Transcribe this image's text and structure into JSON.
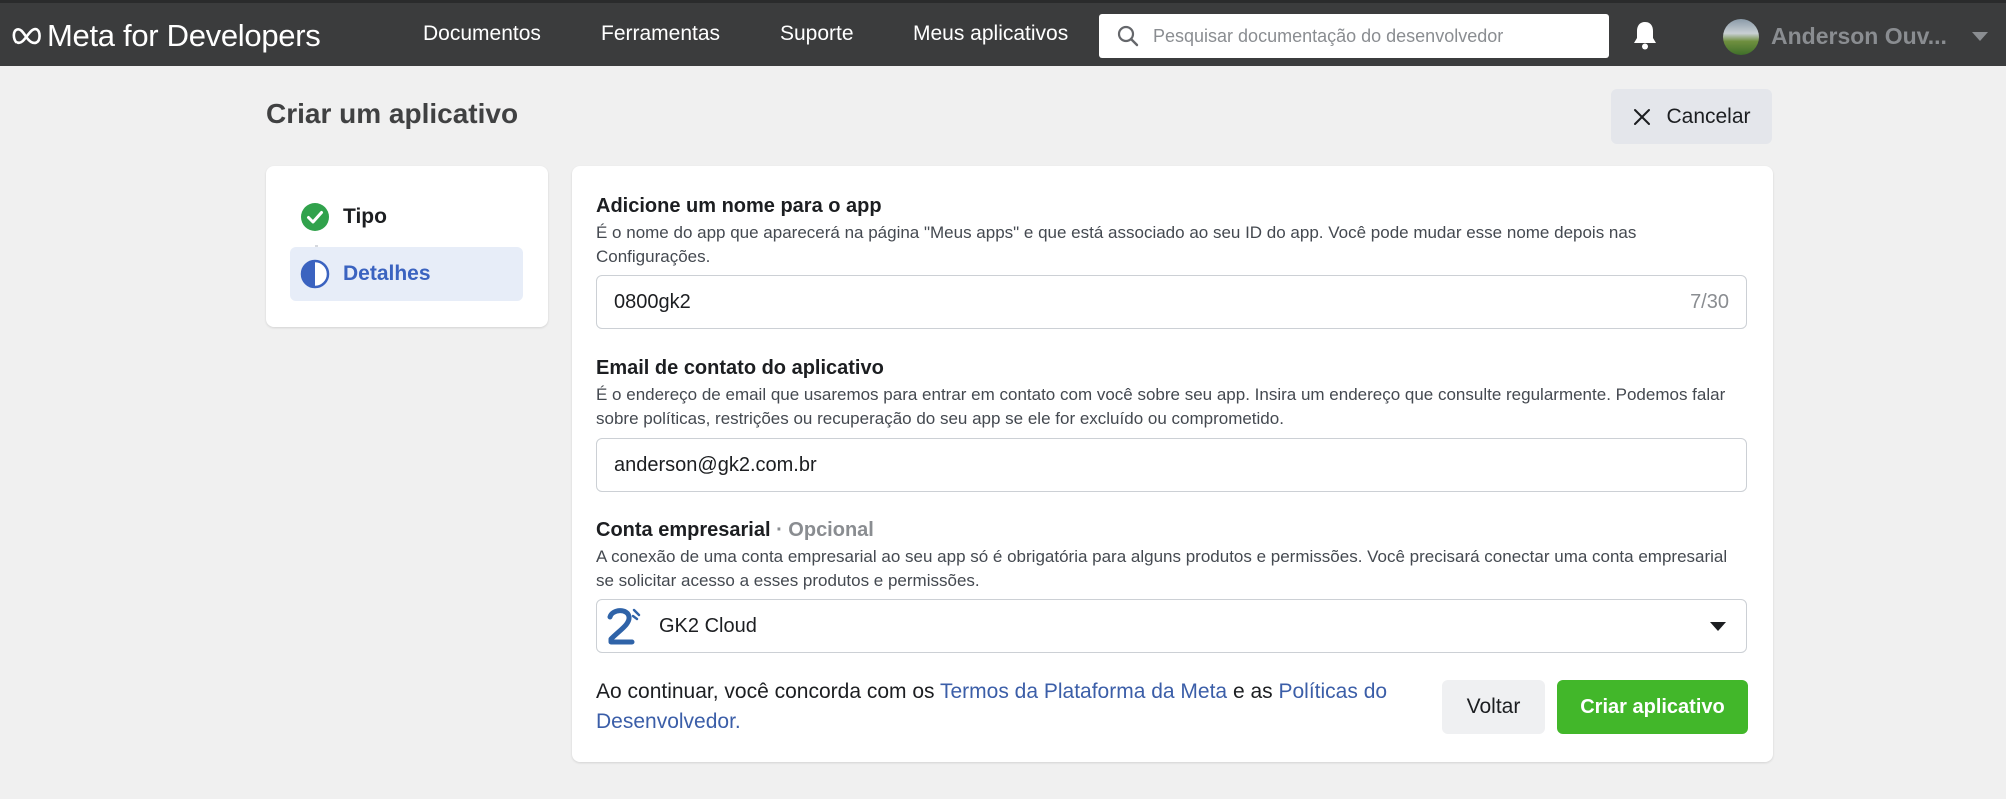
{
  "header": {
    "logo_text": "Meta for Developers",
    "nav": [
      "Documentos",
      "Ferramentas",
      "Suporte",
      "Meus aplicativos"
    ],
    "search_placeholder": "Pesquisar documentação do desenvolvedor",
    "username": "Anderson Ouv..."
  },
  "page": {
    "title": "Criar um aplicativo",
    "cancel_label": "Cancelar"
  },
  "steps": [
    {
      "label": "Tipo",
      "status": "complete",
      "icon": "check-circle-icon"
    },
    {
      "label": "Detalhes",
      "status": "active",
      "icon": "half-circle-icon"
    }
  ],
  "form": {
    "app_name": {
      "label": "Adicione um nome para o app",
      "help": "É o nome do app que aparecerá na página \"Meus apps\" e que está associado ao seu ID do app. Você pode mudar esse nome depois nas Configurações.",
      "value": "0800gk2",
      "counter": "7/30"
    },
    "contact_email": {
      "label": "Email de contato do aplicativo",
      "help": "É o endereço de email que usaremos para entrar em contato com você sobre seu app. Insira um endereço que consulte regularmente. Podemos falar sobre políticas, restrições ou recuperação do seu app se ele for excluído ou comprometido.",
      "value": "anderson@gk2.com.br"
    },
    "business_account": {
      "label": "Conta empresarial",
      "optional": " · Opcional",
      "help": "A conexão de uma conta empresarial ao seu app só é obrigatória para alguns produtos e permissões. Você precisará conectar uma conta empresarial se solicitar acesso a esses produtos e permissões.",
      "value": "GK2 Cloud"
    }
  },
  "footer": {
    "terms_prefix": "Ao continuar, você concorda com os ",
    "terms_link1": "Termos da Plataforma da Meta",
    "terms_middle": " e as ",
    "terms_link2": "Políticas do Desenvolvedor.",
    "back_label": "Voltar",
    "create_label": "Criar aplicativo"
  },
  "colors": {
    "topbar": "#3b3c3d",
    "primary_green": "#42b72a",
    "link_blue": "#3b5ea8",
    "active_step_bg": "#e7edf8"
  }
}
